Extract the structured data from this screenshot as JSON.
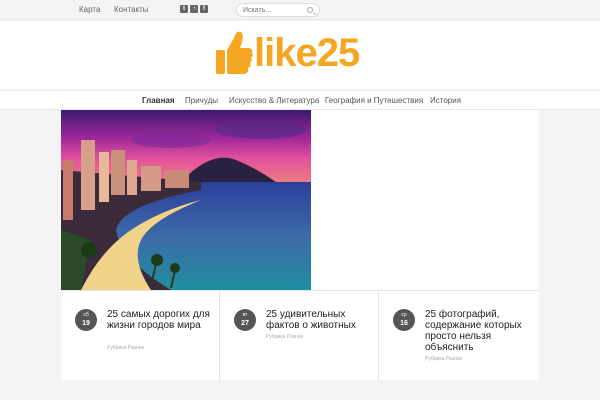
{
  "topbar": {
    "links": [
      "Карта",
      "Контакты"
    ],
    "social_icons": [
      "twitter-icon",
      "rss-icon",
      "facebook-icon"
    ],
    "search_placeholder": "Искать..."
  },
  "header": {
    "logo_text": "like25",
    "logo_color": "#f5a623"
  },
  "nav": {
    "items": [
      "Главная",
      "Причуды",
      "Искусство & Литература",
      "География и Путешествия",
      "История"
    ],
    "active_index": 0
  },
  "posts": [
    {
      "weekday": "сб",
      "day": "19",
      "title": "25 самых дорогих для жизни городов мира",
      "category": "Рубрика Разное"
    },
    {
      "weekday": "вт",
      "day": "27",
      "title": "25 удивительных фактов о животных",
      "category": "Рубрика Разное"
    },
    {
      "weekday": "ср",
      "day": "16",
      "title": "25 фотографий, содержание которых просто нельзя объяснить",
      "category": "Рубрика Разное"
    }
  ]
}
